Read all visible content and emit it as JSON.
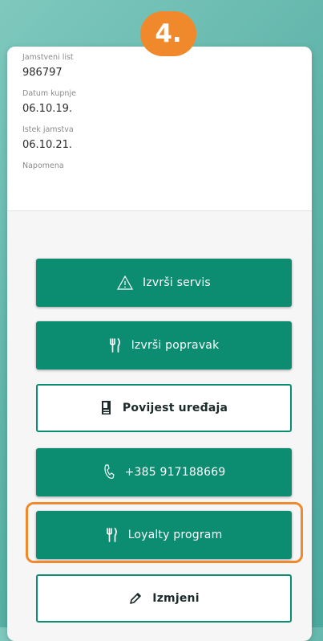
{
  "step_badge": "4.",
  "info": {
    "warranty_label": "Jamstveni list",
    "warranty_value": "986797",
    "purchase_label": "Datum kupnje",
    "purchase_value": "06.10.19.",
    "expiry_label": "Istek jamstva",
    "expiry_value": "06.10.21.",
    "note_label": "Napomena"
  },
  "buttons": {
    "service": "Izvrši servis",
    "repair": "Izvrši popravak",
    "history": "Povijest uređaja",
    "phone": "+385 917188669",
    "loyalty": "Loyalty program",
    "edit": "Izmjeni"
  },
  "icons": {
    "service": "warning-triangle-icon",
    "repair": "fork-knife-icon",
    "history": "device-history-icon",
    "phone": "phone-icon",
    "loyalty": "fork-knife-icon",
    "edit": "pencil-icon"
  },
  "colors": {
    "primary": "#0c8d72",
    "highlight": "#f0892c"
  }
}
